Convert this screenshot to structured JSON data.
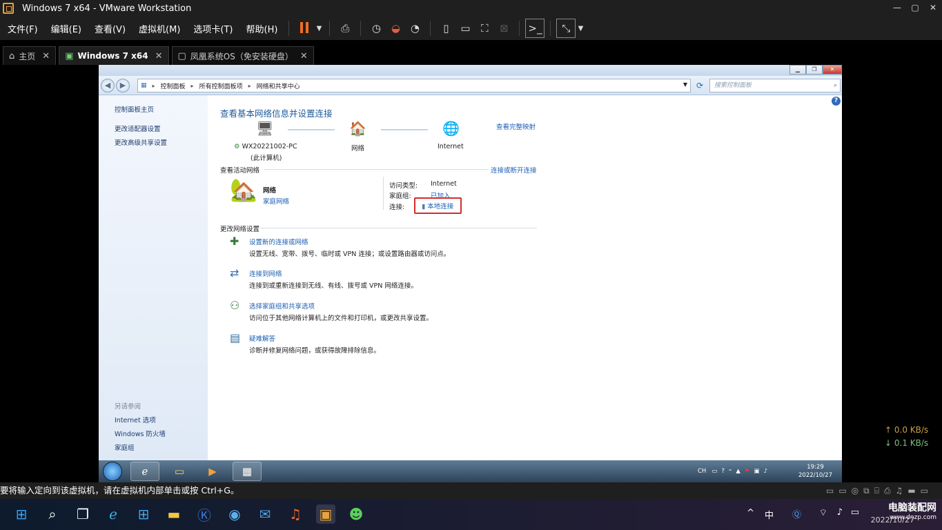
{
  "window": {
    "title": "Windows 7 x64 - VMware Workstation",
    "controls": [
      "—",
      "▢",
      "✕"
    ]
  },
  "menubar": {
    "items": [
      "文件(F)",
      "编辑(E)",
      "查看(V)",
      "虚拟机(M)",
      "选项卡(T)",
      "帮助(H)"
    ]
  },
  "tabs": [
    {
      "label": "主页",
      "icon": "home-icon"
    },
    {
      "label": "Windows 7 x64",
      "icon": "vm-icon",
      "active": true
    },
    {
      "label": "凤凰系统OS（免安装硬盘）",
      "icon": "vm-icon"
    }
  ],
  "guest": {
    "address": {
      "crumbs": [
        "控制面板",
        "所有控制面板项",
        "网络和共享中心"
      ],
      "search_placeholder": "搜索控制面板"
    },
    "left_panel": {
      "home": "控制面板主页",
      "links": [
        "更改适配器设置",
        "更改高级共享设置"
      ],
      "see_also_title": "另请参阅",
      "see_also": [
        "Internet 选项",
        "Windows 防火墙",
        "家庭组"
      ]
    },
    "main": {
      "heading": "查看基本网络信息并设置连接",
      "view_full_map": "查看完整映射",
      "map": {
        "computer_name": "WX20221002-PC",
        "computer_sub": "(此计算机)",
        "network": "网络",
        "internet": "Internet"
      },
      "active_networks_title": "查看活动网络",
      "connect_disconnect": "连接或断开连接",
      "active_network": {
        "name": "网络",
        "type_link": "家庭网络",
        "access_type_label": "访问类型:",
        "access_type_value": "Internet",
        "homegroup_label": "家庭组:",
        "homegroup_value": "已加入",
        "connections_label": "连接:",
        "connections_value": "本地连接"
      },
      "change_settings_title": "更改网络设置",
      "tasks": [
        {
          "title": "设置新的连接或网络",
          "desc": "设置无线、宽带、拨号、临时或 VPN 连接；或设置路由器或访问点。"
        },
        {
          "title": "连接到网络",
          "desc": "连接到或重新连接到无线、有线、拨号或 VPN 网络连接。"
        },
        {
          "title": "选择家庭组和共享选项",
          "desc": "访问位于其他网络计算机上的文件和打印机，或更改共享设置。"
        },
        {
          "title": "疑难解答",
          "desc": "诊断并修复网络问题，或获得故障排除信息。"
        }
      ]
    },
    "taskbar": {
      "lang": "CH",
      "time": "19:29",
      "date": "2022/10/27"
    }
  },
  "host": {
    "status_text": "要将输入定向到该虚拟机，请在虚拟机内部单击或按 Ctrl+G。",
    "upload_speed": "↑ 0.0 KB/s",
    "download_speed": "↓ 0.1 KB/s",
    "tray_ime": "中",
    "watermark_main": "电脑装配网",
    "watermark_sub": "www.dnzp.com",
    "clock_partial": "2022/10/27"
  },
  "colors": {
    "vm_bg": "#1f1f1f",
    "accent_orange": "#f26d21",
    "win7_link": "#1b5fb4",
    "highlight_red": "#d62b2b"
  }
}
